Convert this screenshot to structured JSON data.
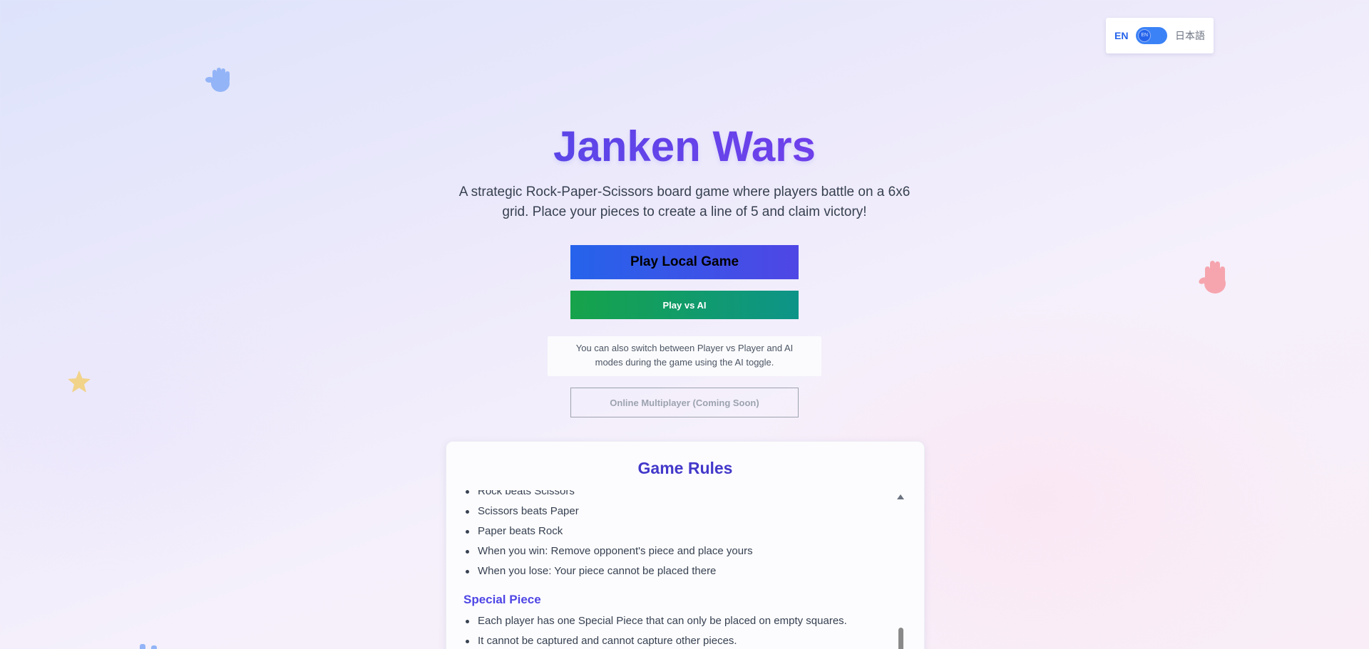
{
  "language": {
    "en_label": "EN",
    "ja_label": "日本語",
    "knob_label": "EN",
    "selected": "EN"
  },
  "hero": {
    "title": "Janken Wars",
    "subtitle": "A strategic Rock-Paper-Scissors board game where players battle on a 6x6 grid. Place your pieces to create a line of 5 and claim victory!"
  },
  "actions": {
    "play_local": "Play Local Game",
    "play_ai": "Play vs AI",
    "mode_note": "You can also switch between Player vs Player and AI modes during the game using the AI toggle.",
    "online": "Online Multiplayer (Coming Soon)"
  },
  "rules": {
    "title": "Game Rules",
    "basic_items": [
      "Rock beats Scissors",
      "Scissors beats Paper",
      "Paper beats Rock",
      "When you win: Remove opponent's piece and place yours",
      "When you lose: Your piece cannot be placed there"
    ],
    "special_heading": "Special Piece",
    "special_items": [
      "Each player has one Special Piece that can only be placed on empty squares.",
      "It cannot be captured and cannot capture other pieces."
    ]
  },
  "decorations": {
    "top_left": "hand-icon",
    "right": "hand-icon",
    "left": "star-icon",
    "bottom_left": "hand-icon"
  },
  "colors": {
    "accent_blue": "#2563eb",
    "accent_indigo": "#4f46e5",
    "accent_green": "#16a34a",
    "title_purple": "#7c3aed",
    "deco_blue": "#93b4f7",
    "deco_pink": "#f6a5ae",
    "deco_yellow": "#f1d38a"
  }
}
